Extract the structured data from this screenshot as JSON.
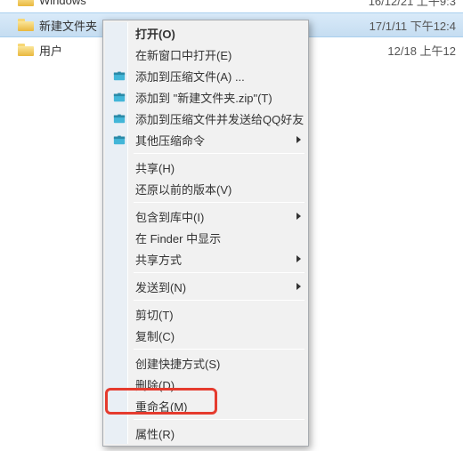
{
  "rows": [
    {
      "name": "Windows",
      "date": "16/12/21 上午9:3"
    },
    {
      "name": "新建文件夹",
      "date": "17/1/11 下午12:4"
    },
    {
      "name": "用户",
      "date": "12/18 上午12"
    }
  ],
  "menu": {
    "open": "打开(O)",
    "openNewWindow": "在新窗口中打开(E)",
    "addToArchive": "添加到压缩文件(A) ...",
    "addToZip": "添加到 \"新建文件夹.zip\"(T)",
    "addAndSendQQ": "添加到压缩文件并发送给QQ好友",
    "otherCompress": "其他压缩命令",
    "share": "共享(H)",
    "restorePrev": "还原以前的版本(V)",
    "includeInLib": "包含到库中(I)",
    "showInFinder": "在 Finder 中显示",
    "shareWith": "共享方式",
    "sendTo": "发送到(N)",
    "cut": "剪切(T)",
    "copy": "复制(C)",
    "createShortcut": "创建快捷方式(S)",
    "delete": "删除(D)",
    "rename": "重命名(M)",
    "properties": "属性(R)"
  }
}
